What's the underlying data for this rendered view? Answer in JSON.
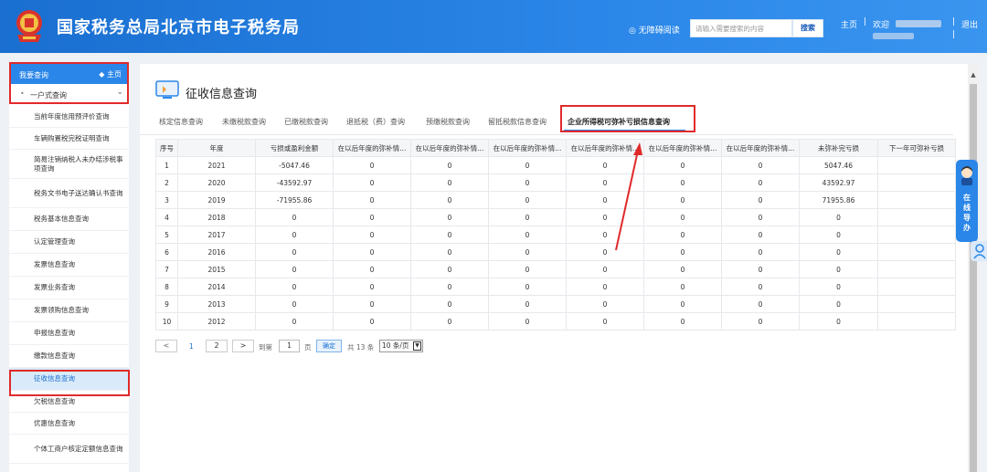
{
  "header": {
    "title": "国家税务总局北京市电子税务局",
    "accessibility": "◎ 无障碍阅读",
    "search_placeholder": "请输入需要搜索的内容",
    "search_button": "搜索",
    "home": "主页",
    "separator": "|",
    "welcome": "欢迎",
    "logout": "退出"
  },
  "sidebar": {
    "head_label": "我要查询",
    "head_home": "◆ 主页",
    "sub_label": "一户式查询",
    "items": [
      "当前年度信用预评价查询",
      "车辆购置税完税证明查询",
      "简易注销纳税人未办结涉税事项查询",
      "税务文书电子送达确认书查询",
      "税务基本信息查询",
      "认定管理查询",
      "发票信息查询",
      "发票业务查询",
      "发票领购信息查询",
      "申报信息查询",
      "缴款信息查询",
      "征收信息查询",
      "欠税信息查询",
      "优惠信息查询",
      "个体工商户核定定额信息查询"
    ]
  },
  "main": {
    "page_title": "征收信息查询",
    "tabs": [
      "核定信息查询",
      "未缴税款查询",
      "已缴税款查询",
      "退抵税（费）查询",
      "预缴税款查询",
      "留抵税款信息查询",
      "企业所得税可弥补亏损信息查询"
    ],
    "active_tab": 6,
    "table": {
      "headers": [
        "序号",
        "年度",
        "亏损或盈利金额",
        "在以后年度的弥补情...",
        "在以后年度的弥补情...",
        "在以后年度的弥补情...",
        "在以后年度的弥补情...",
        "在以后年度的弥补情...",
        "在以后年度的弥补情...",
        "未弥补完亏损",
        "下一年可弥补亏损"
      ],
      "rows": [
        [
          "1",
          "2021",
          "-5047.46",
          "0",
          "0",
          "0",
          "0",
          "0",
          "0",
          "5047.46",
          ""
        ],
        [
          "2",
          "2020",
          "-43592.97",
          "0",
          "0",
          "0",
          "0",
          "0",
          "0",
          "43592.97",
          ""
        ],
        [
          "3",
          "2019",
          "-71955.86",
          "0",
          "0",
          "0",
          "0",
          "0",
          "0",
          "71955.86",
          ""
        ],
        [
          "4",
          "2018",
          "0",
          "0",
          "0",
          "0",
          "0",
          "0",
          "0",
          "0",
          ""
        ],
        [
          "5",
          "2017",
          "0",
          "0",
          "0",
          "0",
          "0",
          "0",
          "0",
          "0",
          ""
        ],
        [
          "6",
          "2016",
          "0",
          "0",
          "0",
          "0",
          "0",
          "0",
          "0",
          "0",
          ""
        ],
        [
          "7",
          "2015",
          "0",
          "0",
          "0",
          "0",
          "0",
          "0",
          "0",
          "0",
          ""
        ],
        [
          "8",
          "2014",
          "0",
          "0",
          "0",
          "0",
          "0",
          "0",
          "0",
          "0",
          ""
        ],
        [
          "9",
          "2013",
          "0",
          "0",
          "0",
          "0",
          "0",
          "0",
          "0",
          "0",
          ""
        ],
        [
          "10",
          "2012",
          "0",
          "0",
          "0",
          "0",
          "0",
          "0",
          "0",
          "0",
          ""
        ]
      ]
    },
    "pager": {
      "prev": "<",
      "page1": "1",
      "page2": "2",
      "next": ">",
      "goto_label": "到第",
      "goto_value": "1",
      "page_unit": "页",
      "confirm": "确定",
      "total": "共 13 条",
      "page_size": "10 条/页"
    }
  },
  "float_widget": {
    "label": "在线导办"
  },
  "colors": {
    "header_blue": "#2a86e8",
    "active_item_bg": "#d9ebfb",
    "annotation_red": "#e02a2a"
  }
}
